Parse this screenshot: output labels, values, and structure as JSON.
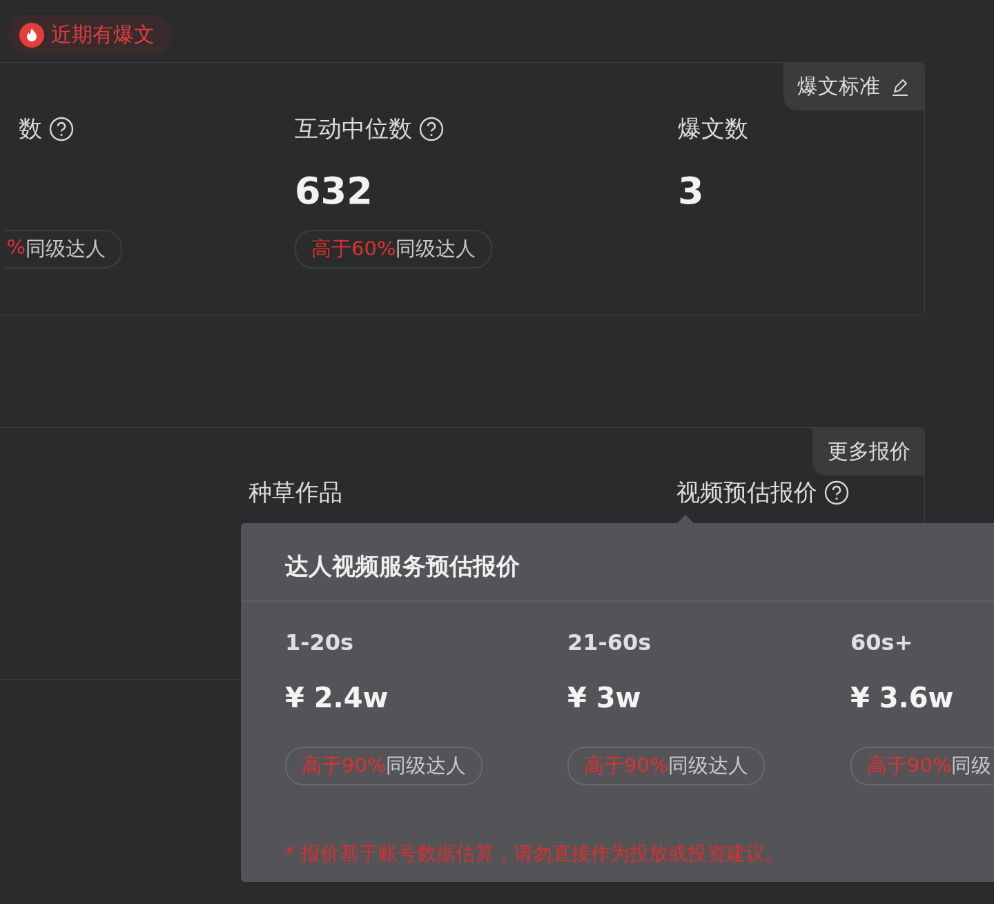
{
  "badge": {
    "label": "近期有爆文"
  },
  "stats_card": {
    "tab": "爆文标准",
    "metrics": [
      {
        "label": "数",
        "help": true,
        "comparison": {
          "highlight": "%",
          "rest": "同级达人"
        }
      },
      {
        "label": "互动中位数",
        "help": true,
        "value": "632",
        "comparison": {
          "highlight": "高于60%",
          "rest": "同级达人"
        }
      },
      {
        "label": "爆文数",
        "help": false,
        "value": "3"
      }
    ]
  },
  "price_card": {
    "tab": "更多报价",
    "columns": [
      {
        "label": "种草作品",
        "help": false
      },
      {
        "label": "视频预估报价",
        "help": true
      }
    ]
  },
  "popover": {
    "title": "达人视频服务预估报价",
    "tiers": [
      {
        "duration": "1-20s",
        "price": "¥ 2.4w",
        "comparison": {
          "highlight": "高于90%",
          "rest": "同级达人"
        }
      },
      {
        "duration": "21-60s",
        "price": "¥ 3w",
        "comparison": {
          "highlight": "高于90%",
          "rest": "同级达人"
        }
      },
      {
        "duration": "60s+",
        "price": "¥ 3.6w",
        "comparison": {
          "highlight": "高于90%",
          "rest": "同级"
        }
      }
    ],
    "note": "* 报价基于账号数据估算，请勿直接作为投放或投资建议。"
  }
}
